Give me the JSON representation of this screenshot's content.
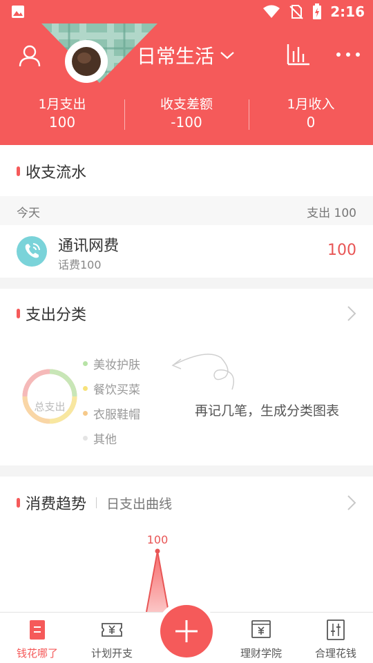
{
  "status_bar": {
    "time": "2:16"
  },
  "header": {
    "book_title": "日常生活",
    "stats": [
      {
        "label": "1月支出",
        "value": "100"
      },
      {
        "label": "收支差额",
        "value": "-100"
      },
      {
        "label": "1月收入",
        "value": "0"
      }
    ]
  },
  "flow": {
    "title": "收支流水",
    "day_label": "今天",
    "day_summary": "支出 100",
    "transaction": {
      "name": "通讯网费",
      "note": "话费100",
      "amount": "100",
      "icon": "phone-icon"
    }
  },
  "category": {
    "title": "支出分类",
    "donut_label": "总支出",
    "legend": [
      {
        "label": "美妆护肤",
        "color": "#b7e3a6"
      },
      {
        "label": "餐饮买菜",
        "color": "#f7e27a"
      },
      {
        "label": "衣服鞋帽",
        "color": "#f6c98a"
      },
      {
        "label": "其他",
        "color": "#e4e4e4"
      }
    ],
    "hint": "再记几笔，生成分类图表"
  },
  "trend": {
    "title": "消费趋势",
    "subtitle": "日支出曲线",
    "chart_data": {
      "type": "area",
      "series": [
        {
          "values": [
            0,
            100,
            0
          ]
        }
      ],
      "peak_label": "100"
    }
  },
  "tabbar": {
    "tabs": [
      {
        "label": "钱花哪了",
        "icon": "ledger-icon",
        "active": true
      },
      {
        "label": "计划开支",
        "icon": "ticket-yuan-icon",
        "active": false
      },
      {
        "label": "",
        "icon": "plus-icon",
        "active": false
      },
      {
        "label": "理财学院",
        "icon": "yuan-book-icon",
        "active": false
      },
      {
        "label": "合理花钱",
        "icon": "sliders-icon",
        "active": false
      }
    ]
  },
  "colors": {
    "accent": "#f55a5a",
    "text_red": "#e85555"
  }
}
